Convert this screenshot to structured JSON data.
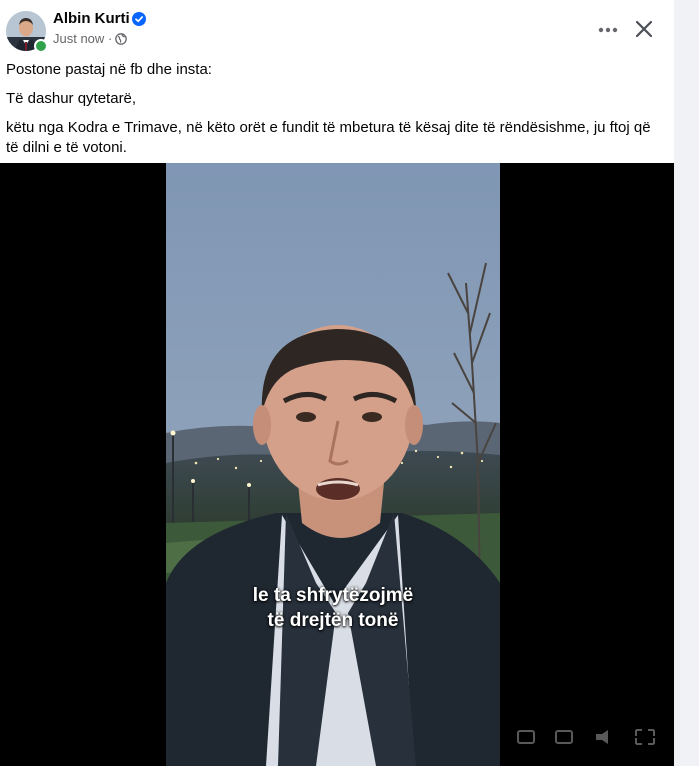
{
  "author": {
    "name": "Albin Kurti",
    "time": "Just now",
    "separator": "·"
  },
  "post": {
    "lines": [
      "Postone pastaj në fb dhe insta:",
      "Të dashur qytetarë,",
      "këtu nga Kodra e Trimave, në këto orët e fundit të mbetura të kësaj dite të rëndësishme, ju ftoj që të dilni e të votoni."
    ]
  },
  "video": {
    "caption_line1": "le ta shfrytëzojmë",
    "caption_line2": "të drejtën tonë"
  },
  "icons": {
    "verified": "verified-badge-icon",
    "privacy": "globe-icon",
    "more": "more-options-icon",
    "close": "close-icon"
  },
  "colors": {
    "verified_blue": "#0866ff",
    "online_green": "#31a24c",
    "text_primary": "#050505",
    "text_secondary": "#65676b"
  }
}
